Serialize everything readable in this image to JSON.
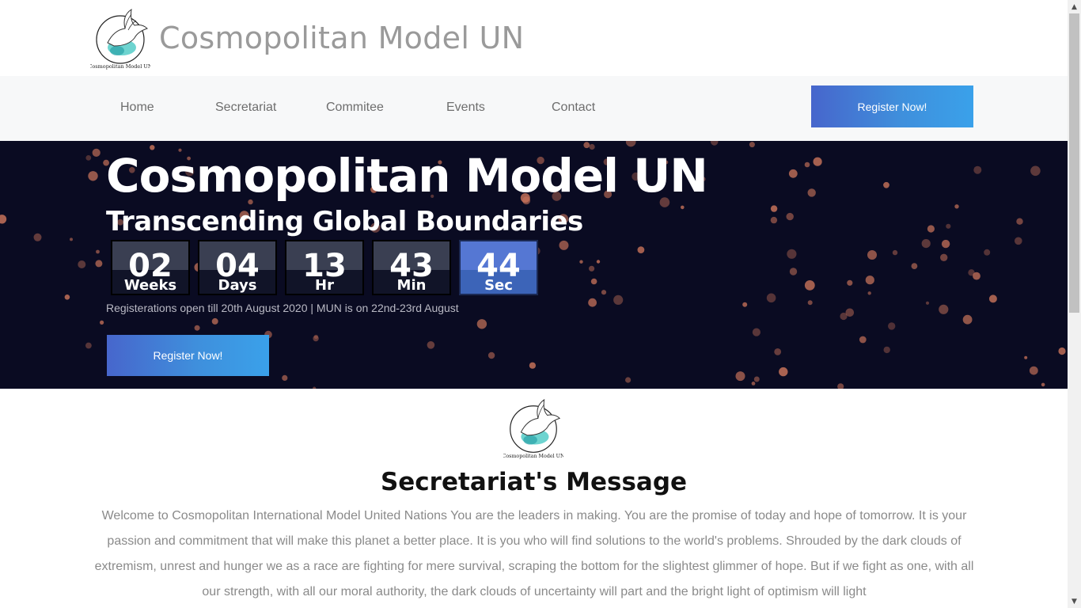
{
  "header": {
    "title": "Cosmopolitan Model UN",
    "logo_caption": "Cosmopolitan Model UN"
  },
  "nav": {
    "items": [
      {
        "label": "Home"
      },
      {
        "label": "Secretariat"
      },
      {
        "label": "Commitee"
      },
      {
        "label": "Events"
      },
      {
        "label": "Contact"
      }
    ],
    "register_label": "Register Now!"
  },
  "hero": {
    "title": "Cosmopolitan Model UN",
    "subtitle": "Transcending Global Boundaries",
    "countdown": [
      {
        "value": "02",
        "unit": "Weeks"
      },
      {
        "value": "04",
        "unit": "Days"
      },
      {
        "value": "13",
        "unit": "Hr"
      },
      {
        "value": "43",
        "unit": "Min"
      },
      {
        "value": "44",
        "unit": "Sec"
      }
    ],
    "note": "Registerations open till 20th August 2020 | MUN is on 22nd-23rd August",
    "register_label": "Register Now!"
  },
  "message": {
    "logo_caption": "Cosmopolitan Model UN",
    "title": "Secretariat's Message",
    "body": "Welcome to Cosmopolitan International Model United Nations You are the leaders in making. You are the promise of today and hope of tomorrow. It is your passion and commitment that will make this planet a better place. It is you who will find solutions to the world's problems. Shrouded by the dark clouds of extremism, unrest and hunger we as a race are fighting for mere survival, scraping the bottom for the slightest glimmer of hope. But if we fight as one, with all our strength, with all our moral authority, the dark clouds of uncertainty will part and the bright light of optimism will light"
  },
  "colors": {
    "accent_start": "#4766cc",
    "accent_end": "#3aa1ea",
    "hero_bg": "#0a0b22",
    "countdown_active": "#5577d3",
    "bokeh": "#c8735a"
  },
  "icons": {
    "logo": "dove-globe-logo",
    "scroll_up": "scroll-up-arrow-icon",
    "scroll_down": "scroll-down-arrow-icon"
  }
}
